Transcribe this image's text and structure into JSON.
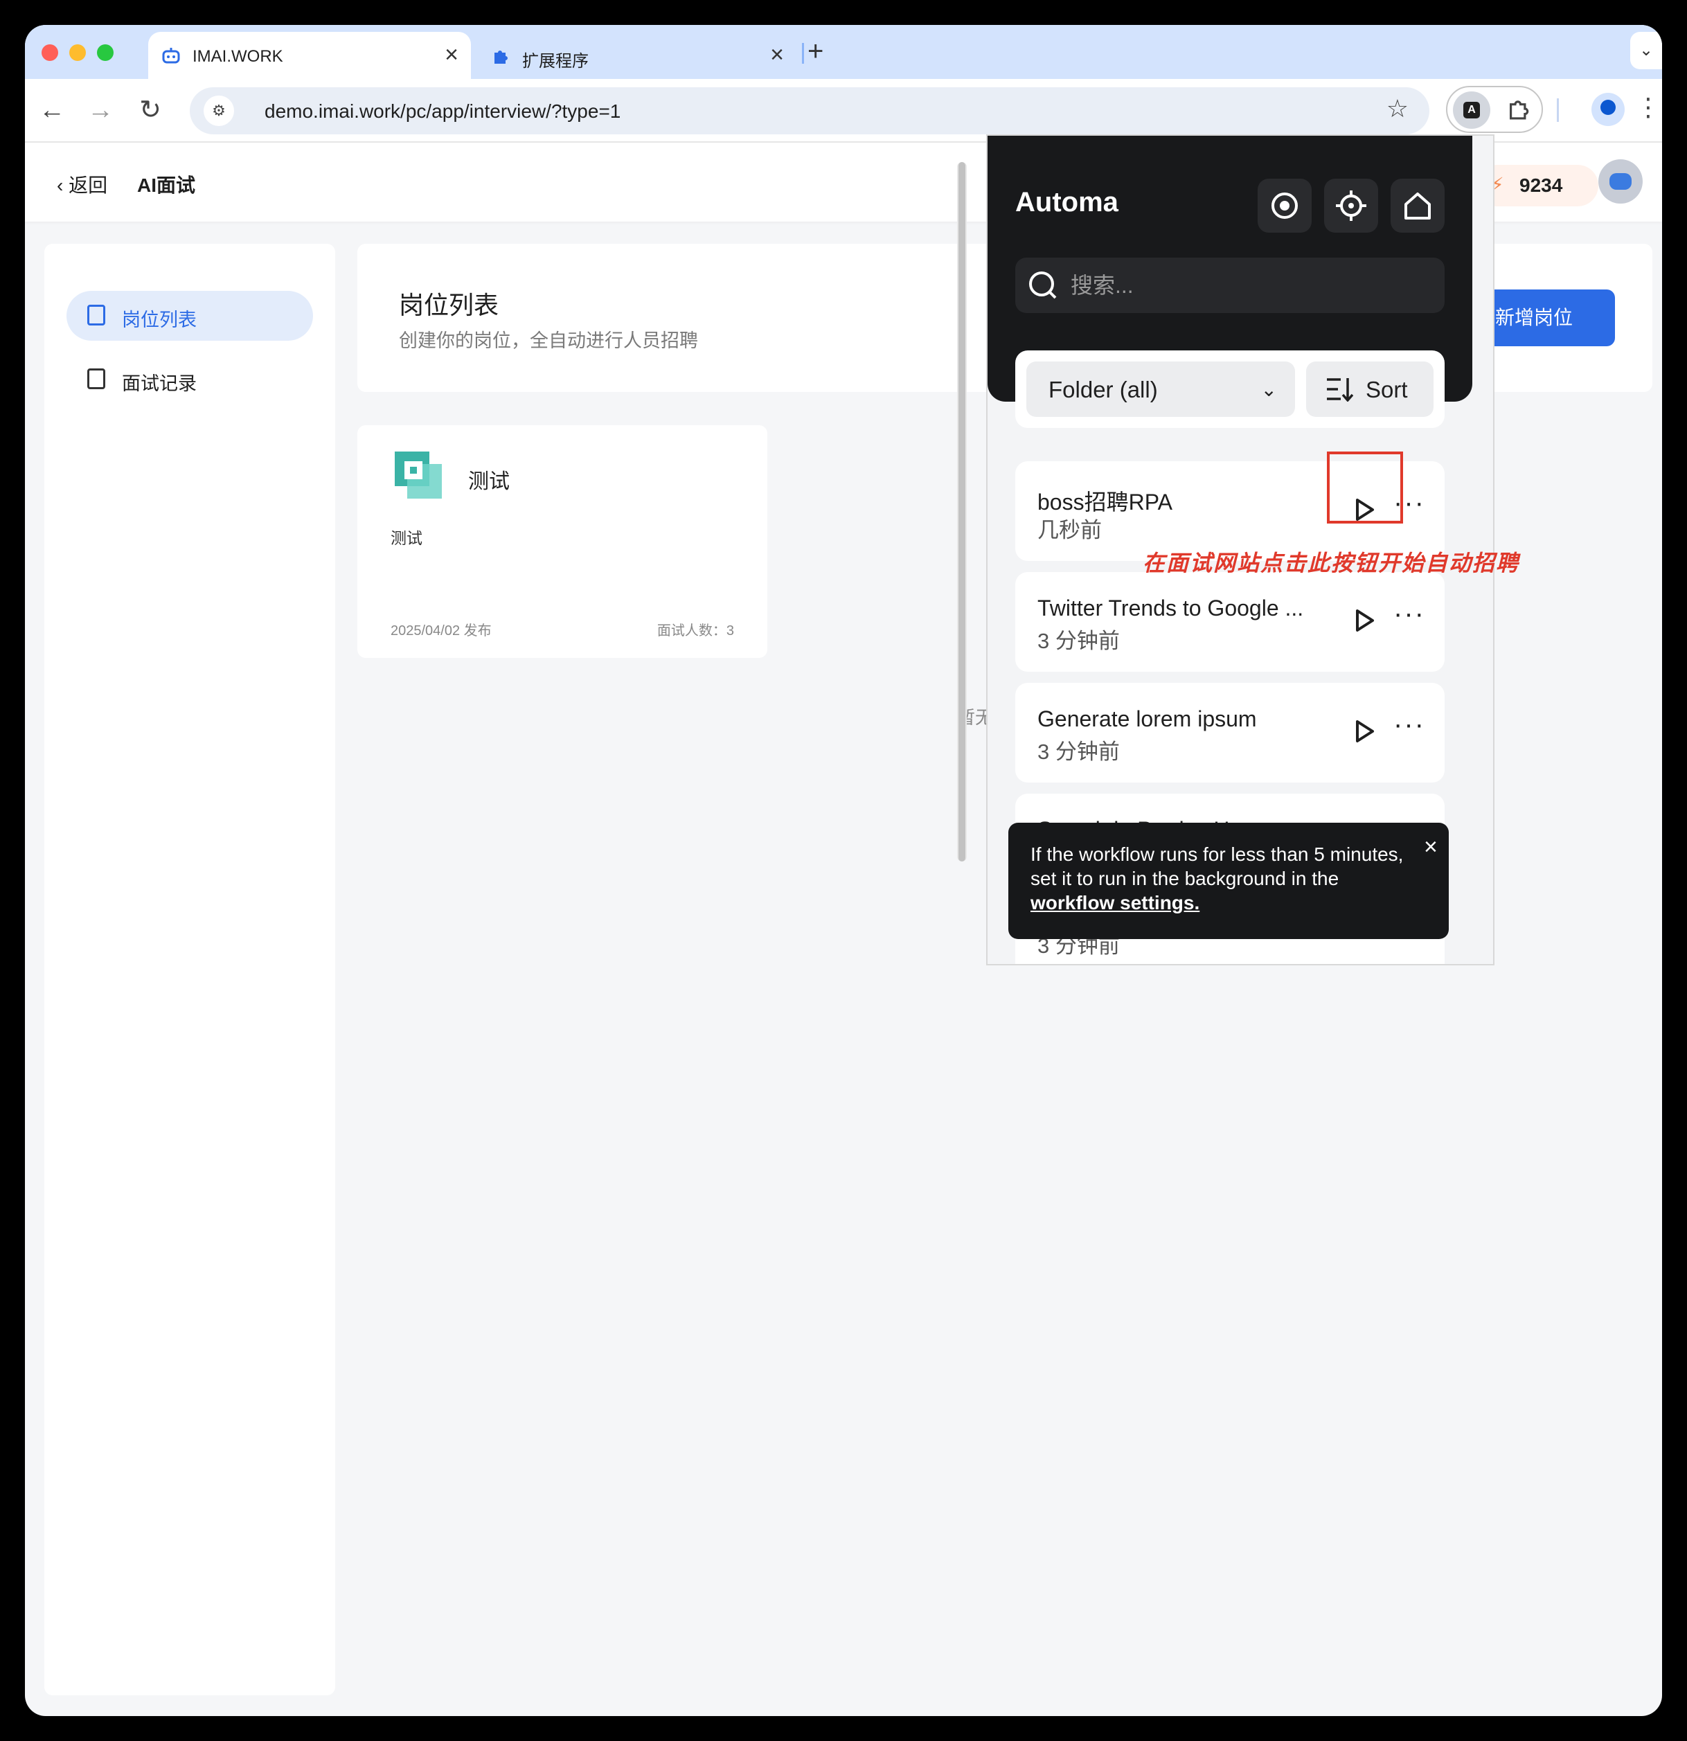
{
  "browser": {
    "tabs": [
      {
        "title": "IMAI.WORK",
        "icon": "robot-icon",
        "active": true
      },
      {
        "title": "扩展程序",
        "icon": "puzzle-icon",
        "active": false
      }
    ],
    "url": "demo.imai.work/pc/app/interview/?type=1"
  },
  "header": {
    "back_label": "返回",
    "title": "AI面试",
    "points": "9234"
  },
  "sidebar": {
    "items": [
      {
        "label": "岗位列表",
        "active": true
      },
      {
        "label": "面试记录",
        "active": false
      }
    ]
  },
  "main": {
    "title": "岗位列表",
    "subtitle": "创建你的岗位，全自动进行人员招聘",
    "add_button": "新增岗位",
    "empty_hint": "暂无",
    "job": {
      "title": "测试",
      "desc": "测试",
      "date": "2025/04/02 发布",
      "count": "面试人数：3"
    }
  },
  "automa": {
    "name": "Automa",
    "search_placeholder": "搜索...",
    "folder_label": "Folder (all)",
    "sort_label": "Sort",
    "workflows": [
      {
        "name": "boss招聘RPA",
        "time": "几秒前"
      },
      {
        "name": "Twitter Trends to Google ...",
        "time": "3 分钟前"
      },
      {
        "name": "Generate lorem ipsum",
        "time": "3 分钟前"
      },
      {
        "name": "Search in ProductHunt",
        "time": ""
      },
      {
        "name": "",
        "time": "3 分钟前"
      }
    ],
    "toast": {
      "text": "If the workflow runs for less than 5 minutes, set it to run in the background in the ",
      "link": "workflow settings."
    }
  },
  "annotation": "在面试网站点击此按钮开始自动招聘",
  "colors": {
    "brand_blue": "#2c6be5",
    "automa_dark": "#18191b",
    "annotation_red": "#e0392b"
  }
}
